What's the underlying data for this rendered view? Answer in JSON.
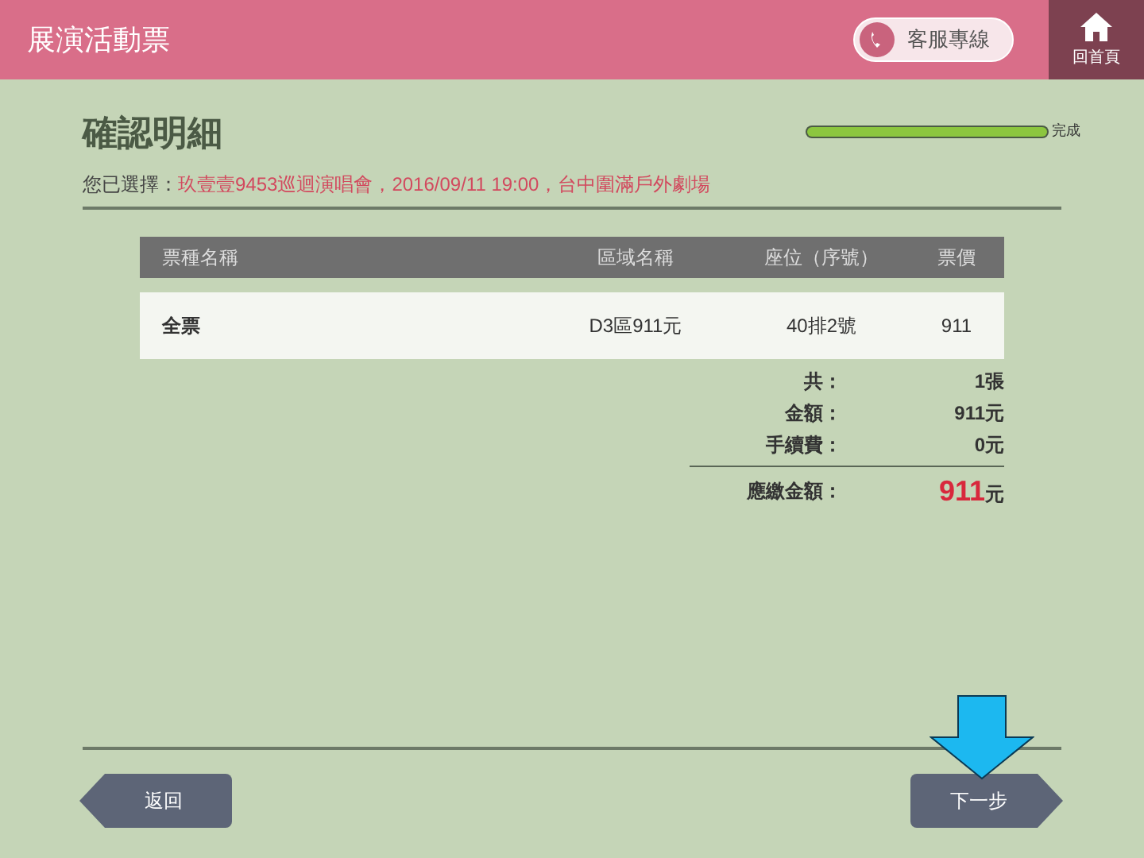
{
  "header": {
    "title": "展演活動票",
    "service_button": "客服專線",
    "home_button": "回首頁"
  },
  "page": {
    "title": "確認明細",
    "progress": {
      "level": 1,
      "label": "完成"
    },
    "selection_label": "您已選擇：",
    "selection_value": "玖壹壹9453巡迴演唱會，2016/09/11 19:00，台中圍滿戶外劇場"
  },
  "table": {
    "columns": [
      "票種名稱",
      "區域名稱",
      "座位（序號）",
      "票價"
    ],
    "rows": [
      {
        "cells": [
          "全票",
          "D3區911元",
          "40排2號",
          "911"
        ]
      }
    ]
  },
  "summary": [
    {
      "label": "共：",
      "value": "1張",
      "kind": "plain"
    },
    {
      "label": "金額：",
      "value": "911元",
      "kind": "plain"
    },
    {
      "label": "手續費：",
      "value": "0元",
      "kind": "plain"
    },
    {
      "label": "應繳金額：",
      "amount": "911",
      "unit": "元",
      "kind": "total"
    }
  ],
  "buttons": {
    "back": "返回",
    "next": "下一步"
  }
}
